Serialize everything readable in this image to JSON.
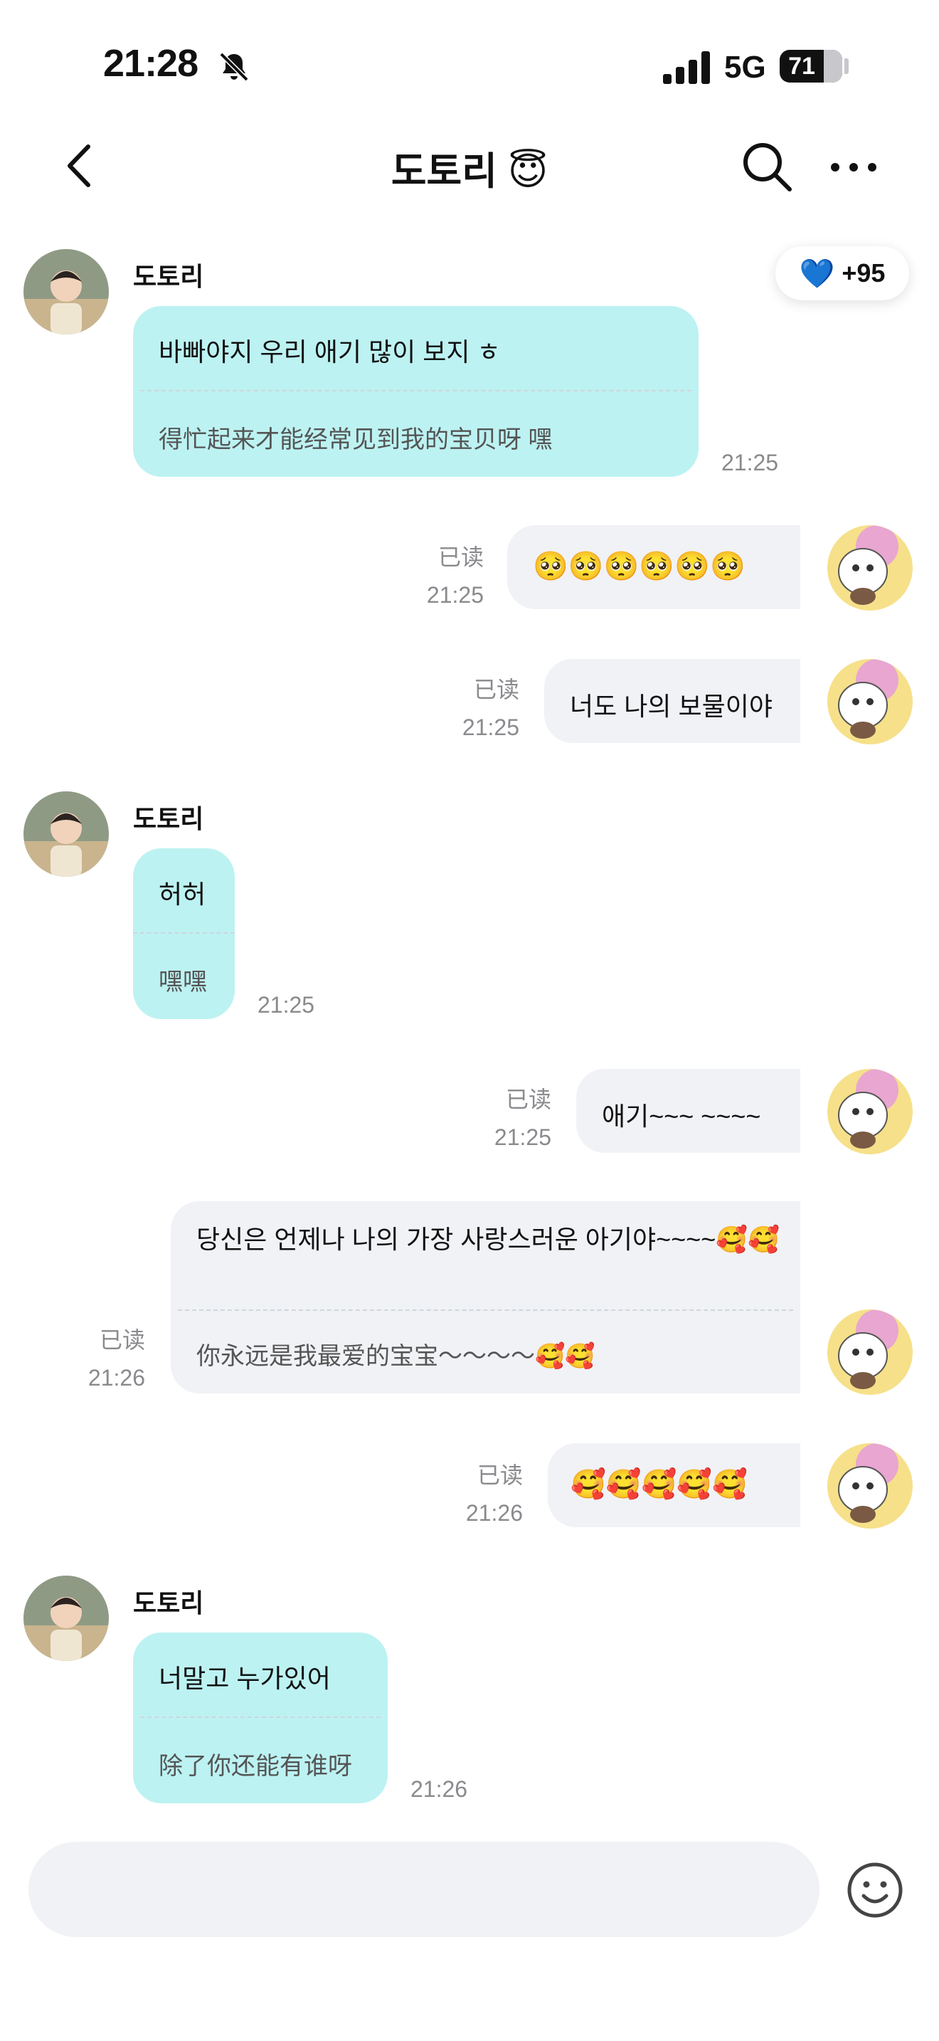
{
  "status_bar": {
    "time": "21:28",
    "network": "5G",
    "battery": "71"
  },
  "header": {
    "title": "도토리 😇"
  },
  "badge": {
    "heart": "💙",
    "value": "+95"
  },
  "messages": [
    {
      "side": "in",
      "sender": "도토리",
      "text": "바빠야지 우리 애기 많이 보지 ㅎ",
      "translation": "得忙起来才能经常见到我的宝贝呀 嘿",
      "time": "21:25"
    },
    {
      "side": "out",
      "read": "已读",
      "time": "21:25",
      "text": "🥺🥺🥺🥺🥺🥺"
    },
    {
      "side": "out",
      "read": "已读",
      "time": "21:25",
      "text": "너도 나의 보물이야"
    },
    {
      "side": "in",
      "sender": "도토리",
      "text": "허허",
      "translation": "嘿嘿",
      "time": "21:25"
    },
    {
      "side": "out",
      "read": "已读",
      "time": "21:25",
      "text": "애기~~~ ~~~~"
    },
    {
      "side": "out",
      "read": "已读",
      "time": "21:26",
      "text": "당신은 언제나 나의 가장 사랑스러운 아기야~~~~🥰🥰",
      "translation": "你永远是我最爱的宝宝～～～～🥰🥰"
    },
    {
      "side": "out",
      "read": "已读",
      "time": "21:26",
      "text": "🥰🥰🥰🥰🥰"
    },
    {
      "side": "in",
      "sender": "도토리",
      "text": "너말고 누가있어",
      "translation": "除了你还能有谁呀",
      "time": "21:26"
    }
  ]
}
